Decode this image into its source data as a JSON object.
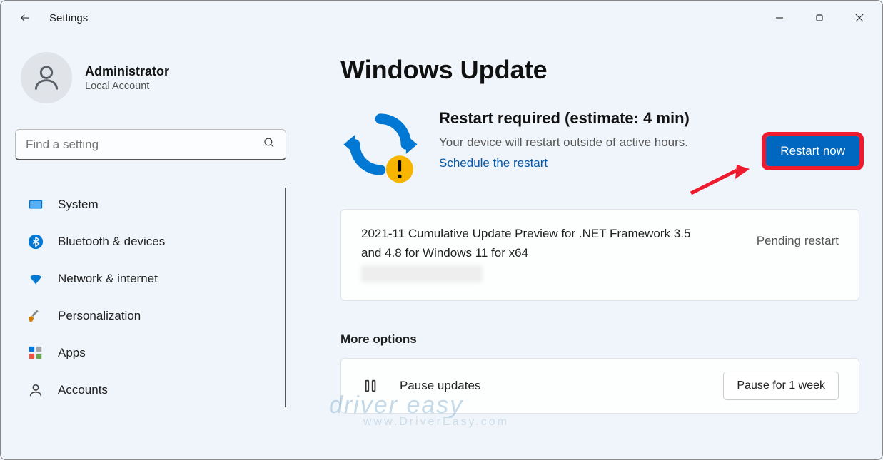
{
  "app": {
    "title": "Settings"
  },
  "user": {
    "name": "Administrator",
    "subtitle": "Local Account"
  },
  "search": {
    "placeholder": "Find a setting"
  },
  "sidebar": {
    "items": [
      {
        "label": "System",
        "icon": "system"
      },
      {
        "label": "Bluetooth & devices",
        "icon": "bluetooth"
      },
      {
        "label": "Network & internet",
        "icon": "wifi"
      },
      {
        "label": "Personalization",
        "icon": "brush"
      },
      {
        "label": "Apps",
        "icon": "grid"
      },
      {
        "label": "Accounts",
        "icon": "person"
      }
    ]
  },
  "page": {
    "title": "Windows Update"
  },
  "banner": {
    "title": "Restart required (estimate: 4 min)",
    "subtitle": "Your device will restart outside of active hours.",
    "link": "Schedule the restart",
    "button": "Restart now"
  },
  "updates": [
    {
      "name": "2021-11 Cumulative Update Preview for .NET Framework 3.5 and 4.8 for Windows 11 for x64",
      "status": "Pending restart"
    }
  ],
  "more": {
    "section_label": "More options",
    "pause": {
      "label": "Pause updates",
      "button": "Pause for 1 week"
    }
  },
  "watermark": {
    "main": "driver easy",
    "sub": "www.DriverEasy.com"
  }
}
